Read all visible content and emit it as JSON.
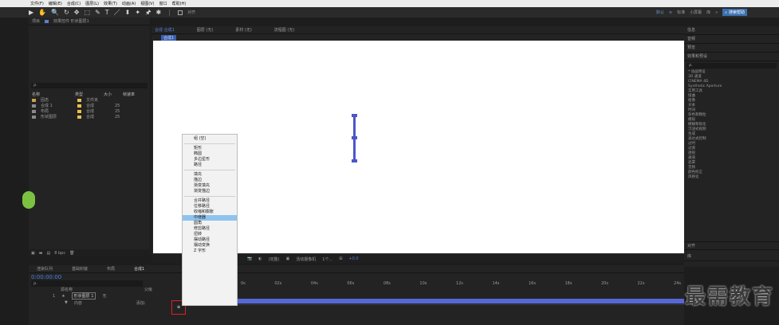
{
  "menu": [
    "文件(F)",
    "编辑(E)",
    "合成(C)",
    "图层(L)",
    "效果(T)",
    "动画(A)",
    "视图(V)",
    "窗口",
    "帮助(H)"
  ],
  "toolbar": {
    "tools": [
      "▶",
      "✋",
      "🔍",
      "↻",
      "✥",
      "⬚",
      "✎",
      "T",
      "／",
      "⬍",
      "✦",
      "🖈",
      "✱"
    ],
    "snap_label": "对齐",
    "workspaces": [
      "默认",
      "≡",
      "标准",
      "小屏幕",
      "库",
      "»"
    ],
    "search_label": "搜索帮助"
  },
  "project": {
    "tab_label": "项目",
    "effects_tab_label": "效果控件 形状图层1",
    "search_placeholder": "ρ.",
    "columns": [
      "名称",
      "类型",
      "大小",
      "帧速率"
    ],
    "items": [
      {
        "name": "固态",
        "type": "文件夹",
        "size": "",
        "color": "#e8c14a"
      },
      {
        "name": "合成 1",
        "type": "合成",
        "size": "25",
        "color": "#e8c14a"
      },
      {
        "name": "布局",
        "type": "合成",
        "size": "25",
        "color": "#e8c14a"
      },
      {
        "name": "形状图层",
        "type": "合成",
        "size": "25",
        "color": "#e8c14a"
      }
    ],
    "bpc": "8 bpc"
  },
  "composition": {
    "tabs": [
      "合成 合成1",
      "图层 (无)",
      "素材 (无)",
      "流程图 (无)"
    ],
    "breadcrumb": "合成1",
    "zoom": "(完整)",
    "camera": "活动摄像机",
    "views": "1个...",
    "exposure": "+0.0"
  },
  "context_menu": {
    "items": [
      "组 (空)",
      "矩形",
      "椭圆",
      "多边星形",
      "路径",
      "填充",
      "描边",
      "渐变填充",
      "渐变描边",
      "合并路径",
      "位移路径",
      "收缩和膨胀",
      "中继器",
      "圆角",
      "修剪路径",
      "扭转",
      "摆动路径",
      "摆动变换",
      "Z 字形"
    ],
    "highlighted": "中继器"
  },
  "timeline": {
    "tabs": [
      "渲染队列",
      "基础封装",
      "布局",
      "合成1"
    ],
    "timecode": "0:00:00:00",
    "search_placeholder": "ρ.",
    "columns": [
      "源名称",
      "父级"
    ],
    "layer": {
      "index": "1",
      "name": "形状图层 1",
      "parent": "无"
    },
    "sublayer": "内容",
    "ruler": [
      "0s",
      "02s",
      "04s",
      "06s",
      "08s",
      "10s",
      "12s",
      "14s",
      "16s",
      "18s",
      "20s",
      "22s",
      "24s"
    ],
    "add_label": "添加:"
  },
  "right_panel": {
    "items": [
      "信息",
      "音频",
      "预览",
      "效果和预设"
    ],
    "search_placeholder": "ρ.",
    "effects": [
      "* 动画预设",
      "3D 通道",
      "CINEMA 4D",
      "Synthetic Aperture",
      "实用工具",
      "扭曲",
      "抠像",
      "文本",
      "时间",
      "杂色和颗粒",
      "模拟",
      "模糊和锐化",
      "沉浸式视频",
      "生成",
      "表达式控制",
      "过时",
      "过渡",
      "透视",
      "通道",
      "遮罩",
      "音频",
      "颜色校正",
      "风格化"
    ],
    "bottom": [
      "对齐",
      "库"
    ]
  },
  "watermark": "最需教育"
}
